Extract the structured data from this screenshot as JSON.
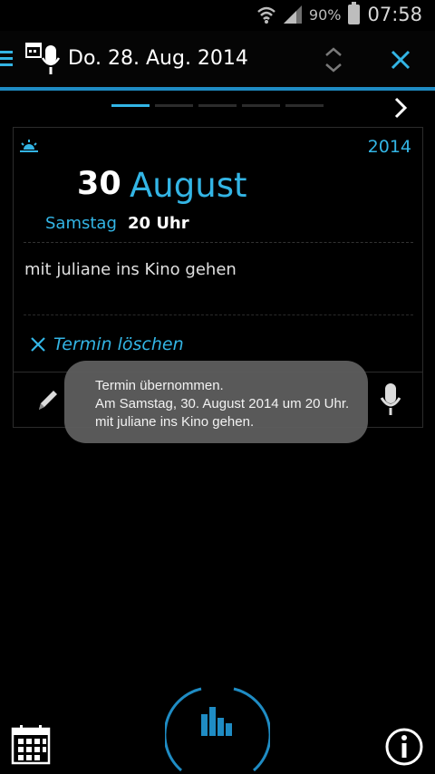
{
  "status_bar": {
    "battery": "90%",
    "time": "07:58"
  },
  "action_bar": {
    "title": "Do. 28. Aug. 2014",
    "icons": [
      "menu-icon",
      "calendar-mic-icon",
      "up-down-icon",
      "close-icon"
    ]
  },
  "pager": {
    "pages": 5,
    "active_index": 0
  },
  "event": {
    "year": "2014",
    "day": "30",
    "month": "August",
    "weekday": "Samstag",
    "time": "20 Uhr",
    "text": "mit juliane ins Kino gehen",
    "delete_label": "Termin löschen"
  },
  "toast": {
    "line1": "Termin übernommen.",
    "line2": "Am Samstag, 30. August 2014 um 20 Uhr.",
    "line3": "mit juliane ins Kino gehen."
  },
  "colors": {
    "accent": "#33b5e5",
    "background": "#000000",
    "toast": "#5e5e5e"
  }
}
